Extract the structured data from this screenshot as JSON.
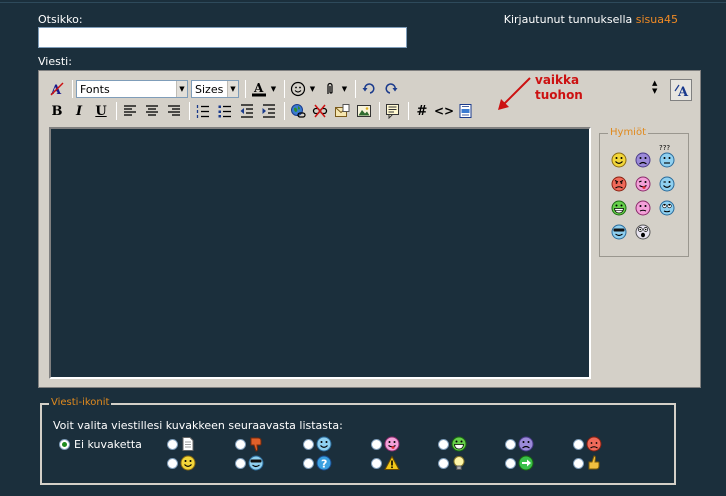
{
  "header": {
    "title_label": "Otsikko:",
    "title_value": "",
    "login_prefix": "Kirjautunut tunnuksella ",
    "login_user": "sisua45",
    "message_label": "Viesti:"
  },
  "toolbar": {
    "font_select": "Fonts",
    "size_select": "Sizes",
    "bold": "B",
    "italic": "I",
    "underline": "U",
    "hash": "#",
    "code": "<>"
  },
  "annotation": {
    "line1": "vaikka",
    "line2": "tuohon"
  },
  "smilies": {
    "legend": "Hymiöt",
    "items": [
      "smile",
      "sad",
      "confused",
      "mad",
      "tongue",
      "wink",
      "grin",
      "frown",
      "rolleyes",
      "cool",
      "eek"
    ],
    "confused_mark": "???"
  },
  "post_icons": {
    "legend": "Viesti-ikonit",
    "instruction": "Voit valita viestillesi kuvakkeen seuraavasta listasta:",
    "no_icon_label": "Ei kuvaketta",
    "selected": "Ei kuvaketta",
    "icons": [
      "document",
      "thumbs-down",
      "smile-blue",
      "tongue",
      "grin",
      "sad",
      "mad",
      "smile",
      "cool",
      "question",
      "exclamation",
      "lightbulb",
      "arrow",
      "thumbs-up"
    ]
  },
  "colors": {
    "background": "#1b2f3c",
    "accent": "#f08a24",
    "annotation": "#cc1111",
    "editor_bg": "#d4d0c8"
  }
}
